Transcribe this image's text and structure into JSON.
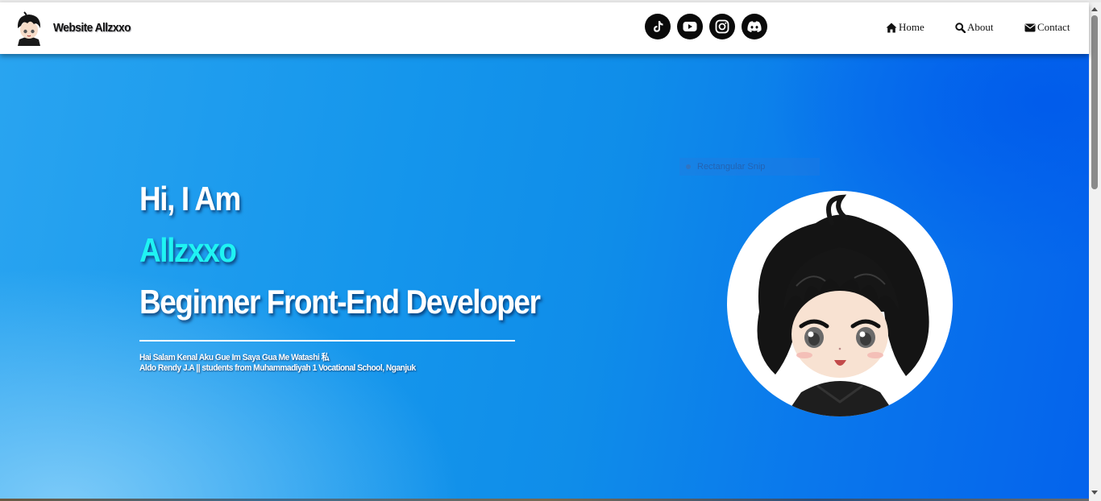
{
  "header": {
    "site_title": "Website Allzxxo",
    "social": [
      {
        "icon": "tiktok-icon"
      },
      {
        "icon": "youtube-icon"
      },
      {
        "icon": "instagram-icon"
      },
      {
        "icon": "discord-icon"
      }
    ],
    "nav": {
      "home": "Home",
      "about": "About",
      "contact": "Contact"
    }
  },
  "hero": {
    "greeting": "Hi, I Am",
    "name": "Allzxxo",
    "role": "Beginner Front-End Developer",
    "subtitle_1": "Hai Salam Kenal Aku Gue Im Saya Gua Me Watashi 私",
    "subtitle_2": "Aldo Rendy J.A || students from Muhammadiyah 1 Vocational School, Nganjuk"
  },
  "overlay": {
    "snip_label": "Rectangular Snip"
  },
  "colors": {
    "accent_name": "#1ff3f3",
    "hero_blue": "#0f8de9",
    "navbar_bg": "#ffffff"
  }
}
